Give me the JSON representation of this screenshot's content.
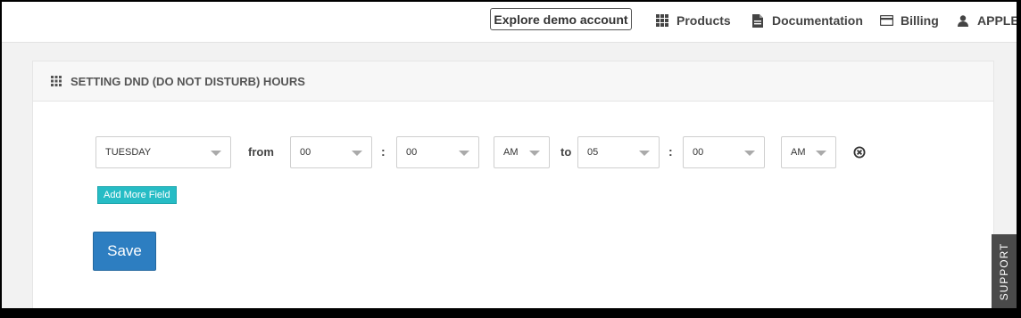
{
  "topbar": {
    "demo_button": "Explore demo account",
    "nav": [
      {
        "label": "Products",
        "icon": "grid-icon"
      },
      {
        "label": "Documentation",
        "icon": "document-icon"
      },
      {
        "label": "Billing",
        "icon": "credit-card-icon"
      },
      {
        "label": "APPLE",
        "icon": "user-icon"
      }
    ]
  },
  "panel": {
    "title": "SETTING DND (DO NOT DISTURB) HOURS",
    "title_icon": "grid-icon"
  },
  "row": {
    "day": "TUESDAY",
    "from_label": "from",
    "from_hour": "00",
    "colon": ":",
    "from_minute": "00",
    "from_ampm": "AM",
    "to_label": "to",
    "to_hour": "05",
    "to_minute": "00",
    "to_ampm": "AM",
    "remove_icon": "close-circle-icon"
  },
  "add_more_label": "Add More Field",
  "save_label": "Save",
  "support_label": "SUPPORT",
  "colors": {
    "save": "#2d7ec1",
    "add_more": "#26bcc5",
    "support": "#4a4a4a"
  }
}
